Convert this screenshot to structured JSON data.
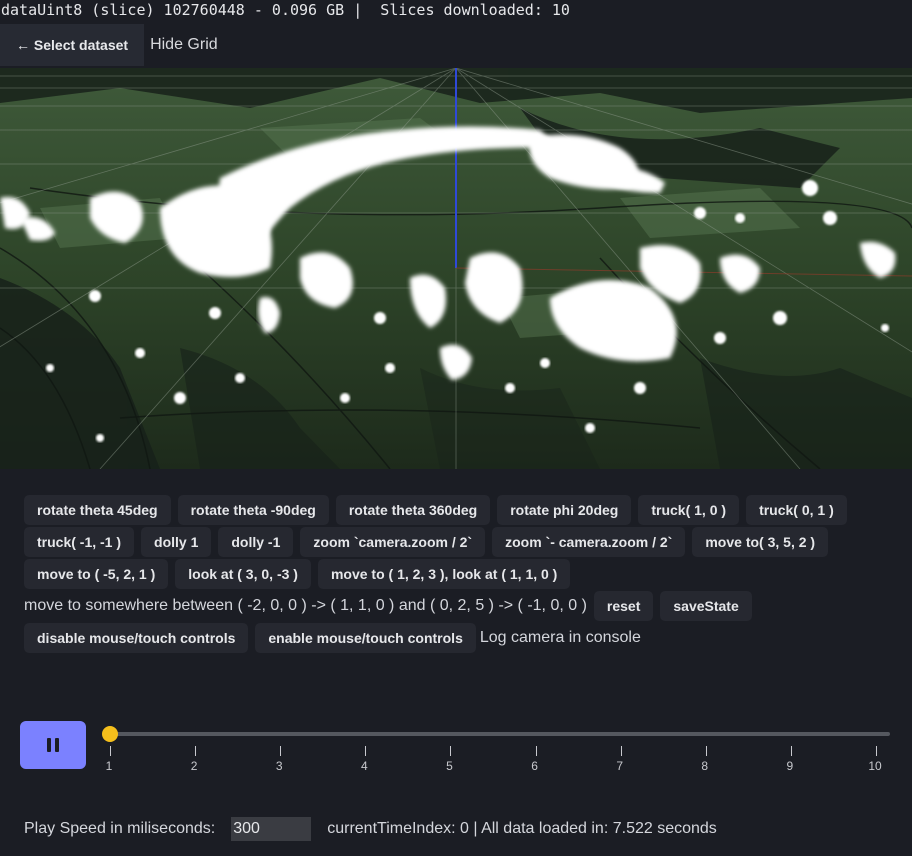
{
  "status_line": "dataUint8 (slice) 102760448 - 0.096 GB |  Slices downloaded: 10",
  "topbar": {
    "back_label": "← Select dataset",
    "hide_grid_label": "Hide Grid"
  },
  "controls": {
    "row1": [
      "rotate theta 45deg",
      "rotate theta -90deg",
      "rotate theta 360deg",
      "rotate phi 20deg",
      "truck( 1, 0 )",
      "truck( 0, 1 )"
    ],
    "row2": [
      "truck( -1, -1 )",
      "dolly 1",
      "dolly -1",
      "zoom `camera.zoom / 2`",
      "zoom `- camera.zoom / 2`",
      "move to( 3, 5, 2 )"
    ],
    "row3": [
      "move to ( -5, 2, 1 )",
      "look at ( 3, 0, -3 )",
      "move to ( 1, 2, 3 ), look at ( 1, 1, 0 )"
    ],
    "row4_text": "move to somewhere between ( -2, 0, 0 ) -> ( 1, 1, 0 ) and ( 0, 2, 5 ) -> ( -1, 0, 0 )",
    "reset_label": "reset",
    "save_state_label": "saveState",
    "disable_controls_label": "disable mouse/touch controls",
    "enable_controls_label": "enable mouse/touch controls",
    "log_camera_label": "Log camera in console"
  },
  "player": {
    "state": "playing",
    "pause_icon": "pause-icon",
    "slider_value": 1,
    "slider_min": 1,
    "slider_max": 10,
    "ticks": [
      "1",
      "2",
      "3",
      "4",
      "5",
      "6",
      "7",
      "8",
      "9",
      "10"
    ]
  },
  "footer": {
    "speed_label": "Play Speed in miliseconds:",
    "speed_value": "300",
    "status_text": "currentTimeIndex: 0 | All data loaded in: 7.522 seconds"
  },
  "colors": {
    "accent": "#7b81ff",
    "slider_thumb": "#f5bf1c",
    "background": "#1b1d24"
  }
}
